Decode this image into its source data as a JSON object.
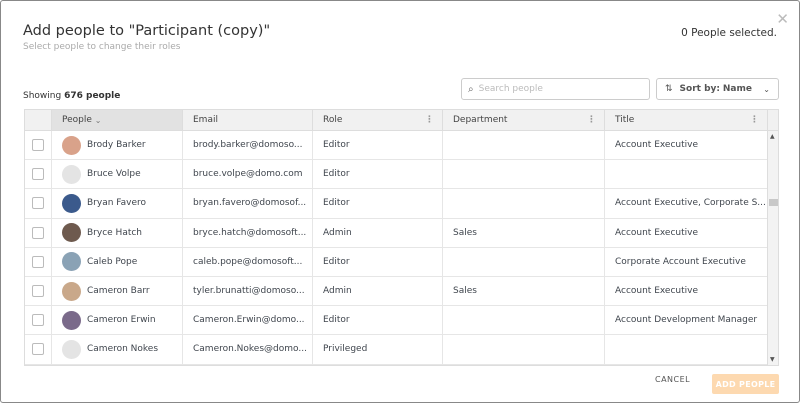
{
  "dialog": {
    "title": "Add people to \"Participant (copy)\"",
    "subtitle": "Select people to change their roles",
    "selected": "0 People selected.",
    "showing_prefix": "Showing",
    "showing_count": "676 people"
  },
  "search": {
    "placeholder": "Search people"
  },
  "sort": {
    "label": "Sort by:",
    "value": "Name"
  },
  "columns": [
    "People",
    "Email",
    "Role",
    "Department",
    "Title"
  ],
  "rows": [
    {
      "name": "Brody Barker",
      "email": "brody.barker@domoso...",
      "role": "Editor",
      "department": "",
      "title": "Account Executive",
      "avatar": "#d9a28a"
    },
    {
      "name": "Bruce Volpe",
      "email": "bruce.volpe@domo.com",
      "role": "Editor",
      "department": "",
      "title": "",
      "avatar": "#e4e4e4"
    },
    {
      "name": "Bryan Favero",
      "email": "bryan.favero@domosof...",
      "role": "Editor",
      "department": "",
      "title": "Account Executive, Corporate S...",
      "avatar": "#3b5a8c"
    },
    {
      "name": "Bryce Hatch",
      "email": "bryce.hatch@domosoft...",
      "role": "Admin",
      "department": "Sales",
      "title": "Account Executive",
      "avatar": "#6e5a4e"
    },
    {
      "name": "Caleb Pope",
      "email": "caleb.pope@domosoft...",
      "role": "Editor",
      "department": "",
      "title": "Corporate Account Executive",
      "avatar": "#8aa2b5"
    },
    {
      "name": "Cameron Barr",
      "email": "tyler.brunatti@domoso...",
      "role": "Admin",
      "department": "Sales",
      "title": "Account Executive",
      "avatar": "#c9a88a"
    },
    {
      "name": "Cameron Erwin",
      "email": "Cameron.Erwin@domo...",
      "role": "Editor",
      "department": "",
      "title": "Account Development Manager",
      "avatar": "#7a6a8a"
    },
    {
      "name": "Cameron Nokes",
      "email": "Cameron.Nokes@domo...",
      "role": "Privileged",
      "department": "",
      "title": "",
      "avatar": "#e4e4e4"
    }
  ],
  "footer": {
    "cancel": "CANCEL",
    "add": "ADD PEOPLE"
  },
  "colors": {
    "accent_disabled": "#fdd9b0"
  }
}
